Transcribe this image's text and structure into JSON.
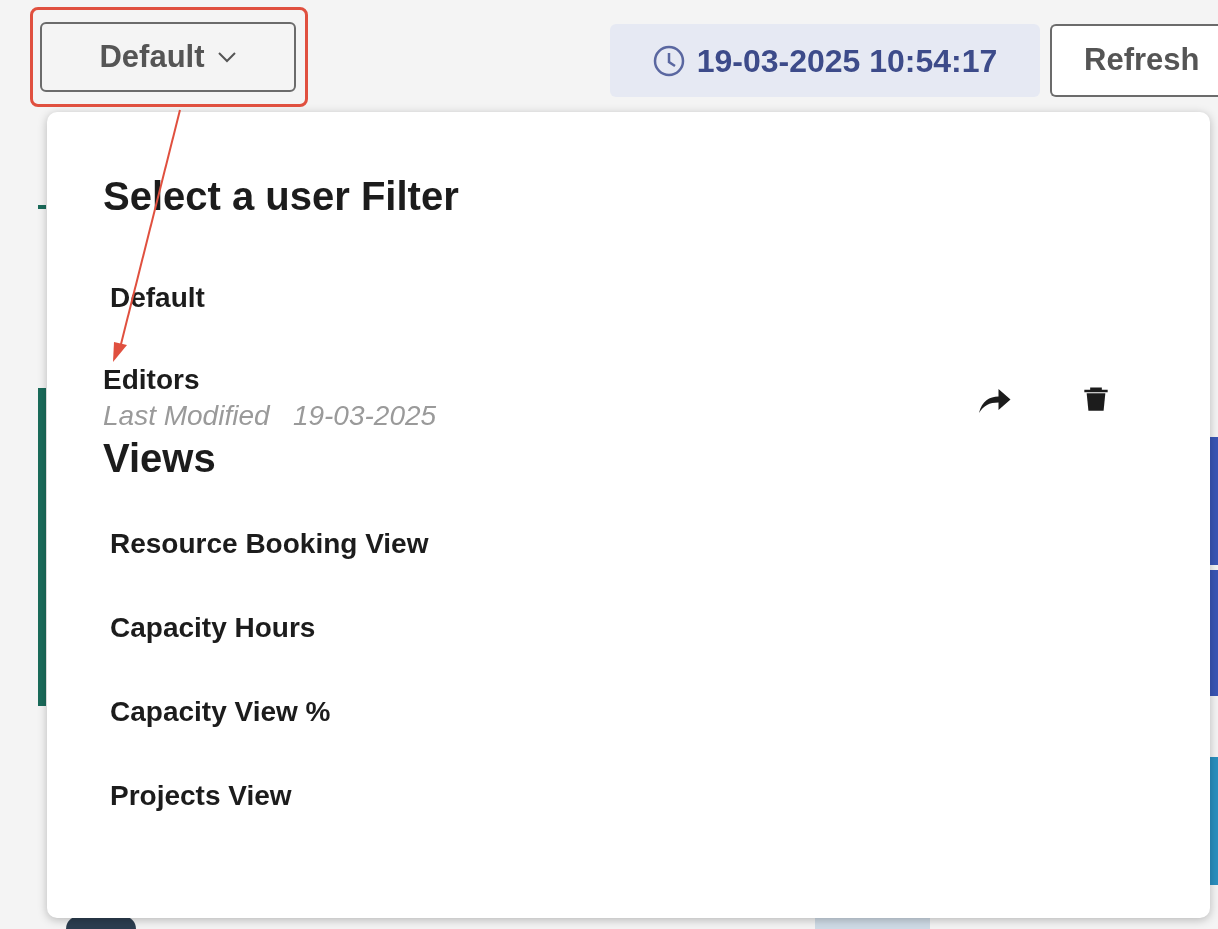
{
  "toolbar": {
    "filter_button": {
      "label": "Default",
      "annotated": true
    },
    "timestamp": "19-03-2025 10:54:17",
    "refresh_button": "Refresh"
  },
  "filter_menu": {
    "title": "Select a user Filter",
    "filters": [
      {
        "name": "Default"
      },
      {
        "name": "Editors",
        "meta_label": "Last Modified",
        "meta_date": "19-03-2025",
        "actions": [
          {
            "kind": "share"
          },
          {
            "kind": "delete"
          }
        ]
      }
    ],
    "views_title": "Views",
    "views": [
      "Resource Booking View",
      "Capacity Hours",
      "Capacity View %",
      "Projects View"
    ]
  }
}
